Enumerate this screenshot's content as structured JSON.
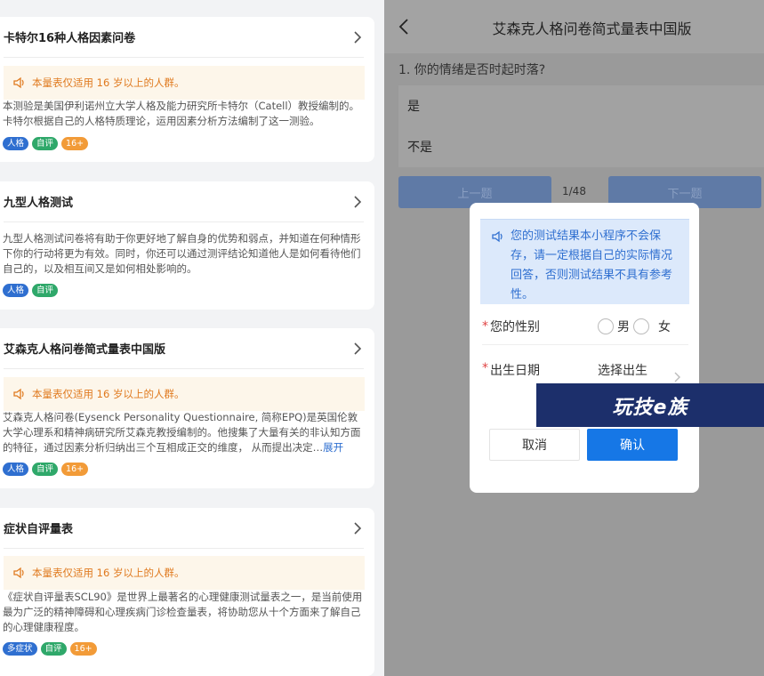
{
  "left": {
    "cards": [
      {
        "title": "卡特尔16种人格因素问卷",
        "notice": "本量表仅适用 16 岁以上的人群。",
        "desc": "本测验是美国伊利诺州立大学人格及能力研究所卡特尔（Catell）教授编制的。卡特尔根据自己的人格特质理论，运用因素分析方法编制了这一测验。",
        "more": "",
        "tags": [
          "人格",
          "自评",
          "16+"
        ]
      },
      {
        "title": "九型人格测试",
        "notice": "",
        "desc": "九型人格测试问卷将有助于你更好地了解自身的优势和弱点，并知道在何种情形下你的行动将更为有效。同时，你还可以通过测评结论知道他人是如何看待他们自己的，以及相互间又是如何相处影响的。",
        "more": "",
        "tags": [
          "人格",
          "自评"
        ]
      },
      {
        "title": "艾森克人格问卷简式量表中国版",
        "notice": "本量表仅适用 16 岁以上的人群。",
        "desc": "艾森克人格问卷(Eysenck Personality Questionnaire, 简称EPQ)是英国伦敦大学心理系和精神病研究所艾森克教授编制的。他搜集了大量有关的非认知方面的特征，通过因素分析归纳出三个互相成正交的维度， 从而提出决定…",
        "more": "展开",
        "tags": [
          "人格",
          "自评",
          "16+"
        ]
      },
      {
        "title": "症状自评量表",
        "notice": "本量表仅适用 16 岁以上的人群。",
        "desc": "《症状自评量表SCL90》是世界上最著名的心理健康测试量表之一，是当前使用最为广泛的精神障碍和心理疾病门诊检查量表，将协助您从十个方面来了解自己的心理健康程度。",
        "more": "",
        "tags": [
          "多症状",
          "自评",
          "16+"
        ]
      }
    ]
  },
  "right": {
    "nav_title": "艾森克人格问卷简式量表中国版",
    "question": "1. 你的情绪是否时起时落?",
    "options": [
      "是",
      "不是"
    ],
    "prev_label": "上一题",
    "next_label": "下一题",
    "progress": "1/48"
  },
  "modal": {
    "notice": "您的测试结果本小程序不会保存，请一定根据自己的实际情况回答，否则测试结果不具有参考性。",
    "gender_label": "您的性别",
    "gender_male": "男",
    "gender_female": "女",
    "birth_label": "出生日期",
    "birth_placeholder": "选择出生",
    "cancel_label": "取消",
    "confirm_label": "确认",
    "required_mark": "*"
  },
  "watermark": "玩技e族",
  "colors": {
    "accent": "#1677e6",
    "tag_blue": "#2f6fd0",
    "tag_green": "#2fa86a",
    "tag_orange": "#f29b38",
    "notice_text": "#e07a1f"
  }
}
